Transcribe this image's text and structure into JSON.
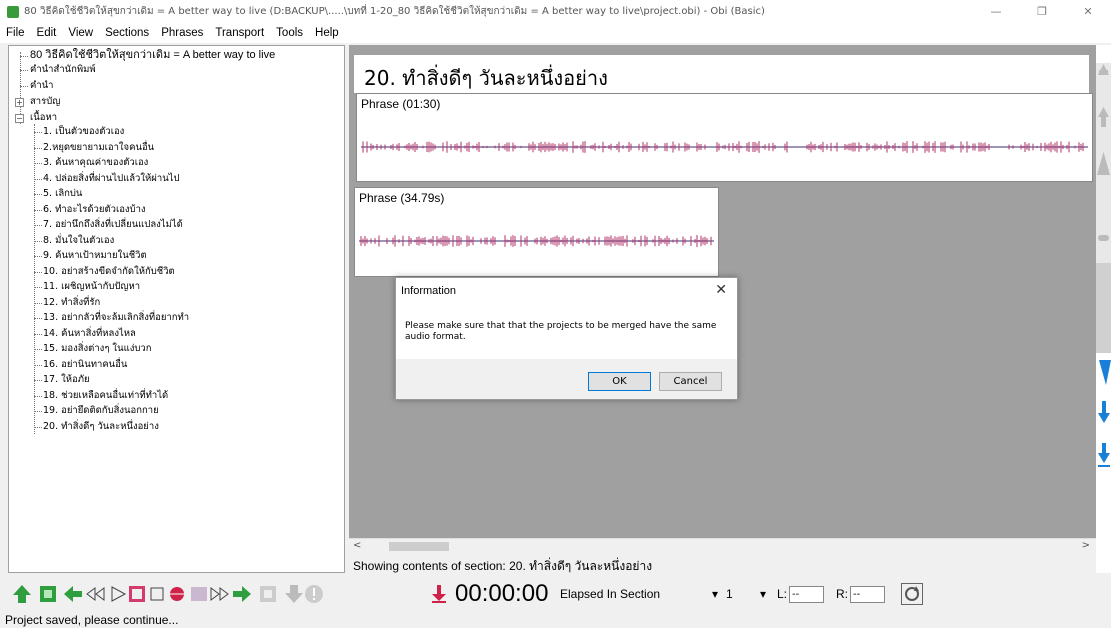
{
  "window": {
    "title": "80 วิธีคิดใช้ชีวิตให้สุขกว่าเดิม = A better way to live (D:BACKUP\\.....\\บทที่ 1-20_80 วิธีคิดใช้ชีวิตให้สุขกว่าเดิม = A better way to live\\project.obi) - Obi (Basic)",
    "minimize": "—",
    "maximize": "❐",
    "close": "✕"
  },
  "menu": [
    "File",
    "Edit",
    "View",
    "Sections",
    "Phrases",
    "Transport",
    "Tools",
    "Help"
  ],
  "tree": {
    "root": "80 วิธีคิดใช้ชีวิตให้สุขกว่าเดิม = A better way to live",
    "top_items": [
      "คำนำสำนักพิมพ์",
      "คำนำ",
      "สารบัญ",
      "เนื้อหา"
    ],
    "children": [
      "1. เป็นตัวของตัวเอง",
      "2.หยุดขยายามเอาใจคนอื่น",
      "3. ค้นหาคุณค่าของตัวเอง",
      "4. ปล่อยสิ่งที่ผ่านไปแล้วให้ผ่านไป",
      "5. เลิกบ่น",
      "6. ทำอะไรด้วยตัวเองบ้าง",
      "7. อย่านึกถึงสิ่งที่เปลี่ยนแปลงไม่ได้",
      "8. มั่นใจในตัวเอง",
      "9. ค้นหาเป้าหมายในชีวิต",
      "10. อย่าสร้างขีดจำกัดให้กับชีวิต",
      "11. เผชิญหน้ากับปัญหา",
      "12. ทำสิ่งที่รัก",
      "13. อย่ากลัวที่จะล้มเลิกสิ่งที่อยากทำ",
      "14. ค้นหาสิ่งที่หลงไหล",
      "15. มองสิ่งต่างๆ ในแง่บวก",
      "16. อย่านินทาคนอื่น",
      "17. ให้อภัย",
      "18. ช่วยเหลือคนอื่นเท่าที่ทำได้",
      "19. อย่ายึดติดกับสิ่งนอกกาย",
      "20. ทำสิ่งดีๆ วันละหนึ่งอย่าง"
    ]
  },
  "content": {
    "section_title": "20. ทำสิ่งดีๆ วันละหนึ่งอย่าง",
    "phrases": [
      {
        "label": "Phrase (01:30)"
      },
      {
        "label": "Phrase (34.79s)"
      }
    ],
    "status": "Showing contents of section:  20. ทำสิ่งดีๆ วันละหนึ่งอย่าง"
  },
  "toolbar": {
    "time": "00:00:00",
    "time_mode": "Elapsed In Section",
    "level": "1",
    "l_label": "L:",
    "r_label": "R:",
    "l_value": "--",
    "r_value": "--"
  },
  "dialog": {
    "title": "Information",
    "message": "Please make sure that that the projects to be merged have the same audio format.",
    "ok": "OK",
    "cancel": "Cancel"
  },
  "statusbar": "Project saved, please continue...",
  "colors": {
    "accent_green": "#2f9e3f",
    "waveform": "#b2336b",
    "scroll_blue": "#1a7fd6"
  }
}
